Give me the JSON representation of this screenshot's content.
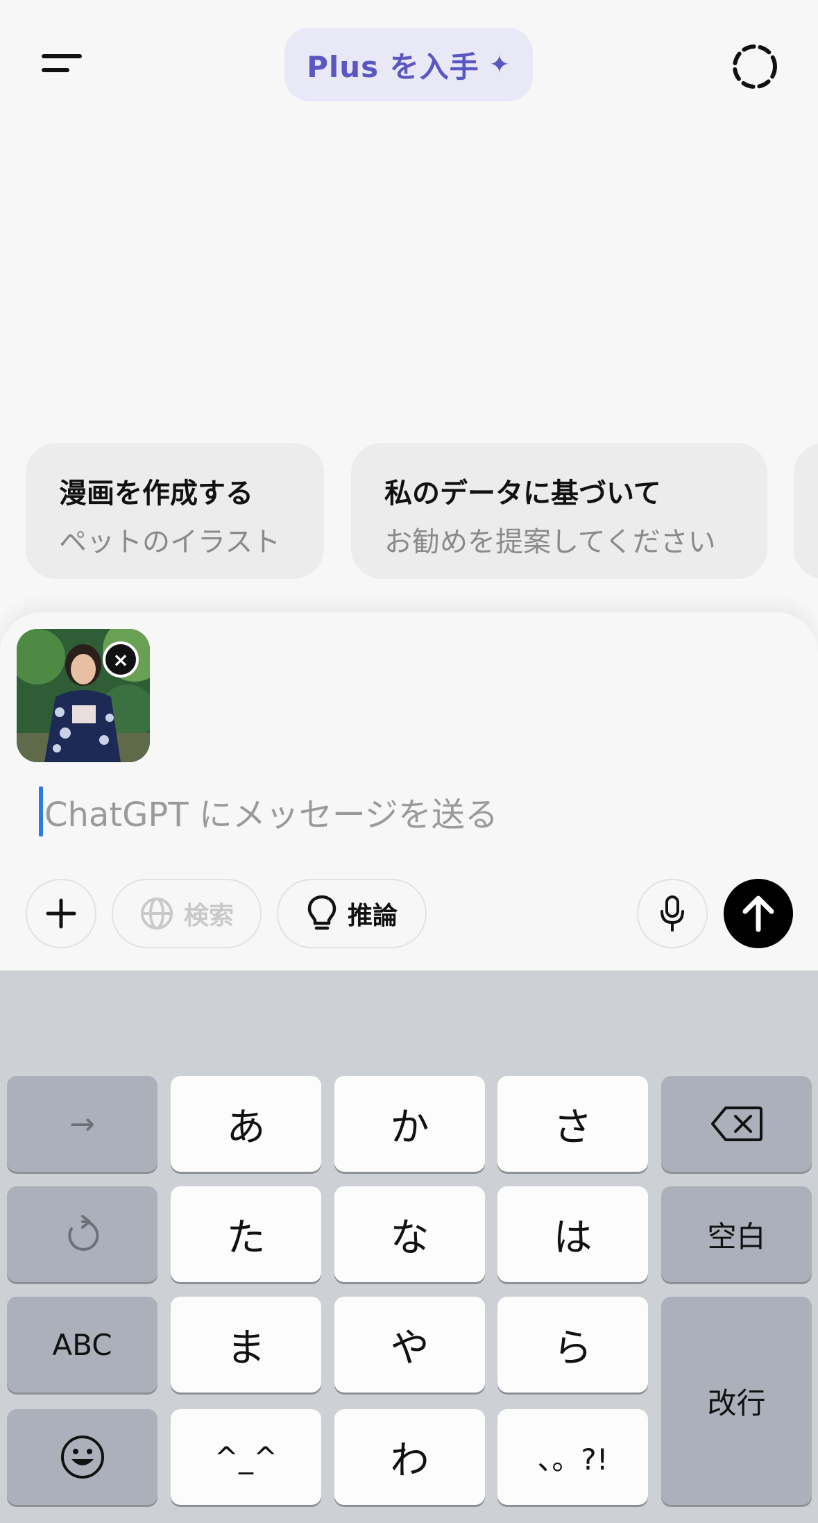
{
  "header": {
    "plus_label": "Plus を入手",
    "plus_icon": "✦"
  },
  "suggestions": [
    {
      "title": "漫画を作成する",
      "subtitle": "ペットのイラスト"
    },
    {
      "title": "私のデータに基づいて",
      "subtitle": "お勧めを提案してください"
    }
  ],
  "composer": {
    "placeholder": "ChatGPT にメッセージを送る",
    "remove_icon": "×",
    "search_label": "検索",
    "reason_label": "推論"
  },
  "keyboard": {
    "rows": [
      [
        "→",
        "あ",
        "か",
        "さ",
        "⌫"
      ],
      [
        "↺",
        "た",
        "な",
        "は",
        "空白"
      ],
      [
        "ABC",
        "ま",
        "や",
        "ら",
        "改行"
      ],
      [
        "☺",
        "^_^",
        "わ",
        "、。?!"
      ]
    ]
  },
  "colors": {
    "accent": "#5a56c2",
    "caret": "#2a7bea",
    "keyboard_bg": "#cdd1d6"
  }
}
